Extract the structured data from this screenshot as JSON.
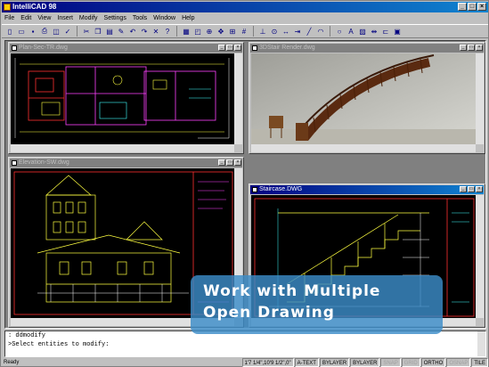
{
  "app": {
    "title": "IntelliCAD 98"
  },
  "menu": [
    "File",
    "Edit",
    "View",
    "Insert",
    "Modify",
    "Settings",
    "Tools",
    "Window",
    "Help"
  ],
  "toolbar_icons": [
    "new-icon",
    "open-icon",
    "save-icon",
    "print-icon",
    "preview-icon",
    "spell-icon",
    "cut-icon",
    "copy-icon",
    "paste-icon",
    "match-icon",
    "undo-icon",
    "redo-icon",
    "delete-icon",
    "help-icon",
    "layer-icon",
    "redraw-icon",
    "zoom-icon",
    "pan-icon",
    "snap-icon",
    "grid-icon",
    "ortho-icon",
    "osnap-icon",
    "dist-icon",
    "measure-icon",
    "line-icon",
    "arc-icon",
    "circle-icon",
    "text-icon",
    "hatch-icon",
    "dim-icon",
    "insert-icon",
    "block-icon"
  ],
  "windows": {
    "plan": {
      "title": "Plan-Sec-TR.dwg"
    },
    "render": {
      "title": "3DStair Render.dwg"
    },
    "elevation": {
      "title": "Elevation-SW.dwg"
    },
    "staircase": {
      "title": "Staircase.DWG"
    }
  },
  "command": {
    "line1": ": ddmodify",
    "line2": ">Select entities to modify:"
  },
  "status": {
    "ready": "Ready",
    "coords": "1'7 1/4\",10'9 1/2\",0\"",
    "panels": [
      {
        "label": "A-TEXT",
        "on": true
      },
      {
        "label": "BYLAYER",
        "on": true
      },
      {
        "label": "BYLAYER",
        "on": true
      },
      {
        "label": "SNAP",
        "on": false
      },
      {
        "label": "GRID",
        "on": false
      },
      {
        "label": "ORTHO",
        "on": true
      },
      {
        "label": "OSNAP",
        "on": false
      },
      {
        "label": "TILE",
        "on": true
      }
    ]
  },
  "callout": {
    "line1": "Work with Multiple",
    "line2": "Open Drawing"
  }
}
